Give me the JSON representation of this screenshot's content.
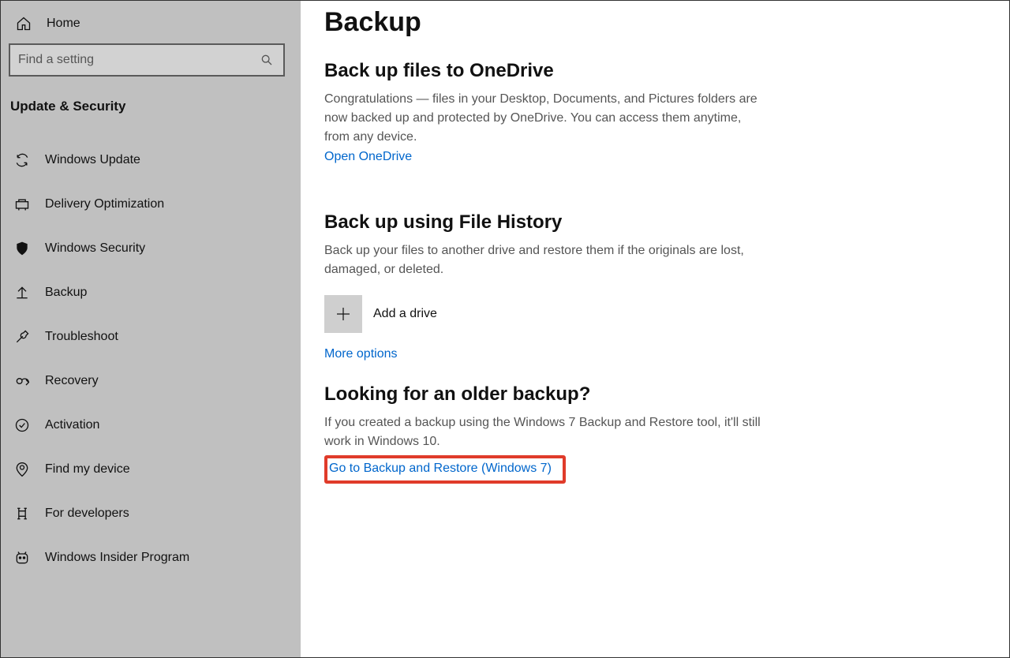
{
  "sidebar": {
    "home_label": "Home",
    "search_placeholder": "Find a setting",
    "category": "Update & Security",
    "items": [
      {
        "label": "Windows Update",
        "icon": "sync-icon"
      },
      {
        "label": "Delivery Optimization",
        "icon": "delivery-icon"
      },
      {
        "label": "Windows Security",
        "icon": "shield-icon"
      },
      {
        "label": "Backup",
        "icon": "backup-icon"
      },
      {
        "label": "Troubleshoot",
        "icon": "wrench-icon"
      },
      {
        "label": "Recovery",
        "icon": "recovery-icon"
      },
      {
        "label": "Activation",
        "icon": "check-circle-icon"
      },
      {
        "label": "Find my device",
        "icon": "location-icon"
      },
      {
        "label": "For developers",
        "icon": "developer-icon"
      },
      {
        "label": "Windows Insider Program",
        "icon": "insider-icon"
      }
    ]
  },
  "main": {
    "page_title": "Backup",
    "sections": {
      "onedrive": {
        "heading": "Back up files to OneDrive",
        "text": "Congratulations — files in your Desktop, Documents, and Pictures folders are now backed up and protected by OneDrive. You can access them anytime, from any device.",
        "link": "Open OneDrive"
      },
      "filehistory": {
        "heading": "Back up using File History",
        "text": "Back up your files to another drive and restore them if the originals are lost, damaged, or deleted.",
        "add_label": "Add a drive",
        "more_link": "More options"
      },
      "older": {
        "heading": "Looking for an older backup?",
        "text": "If you created a backup using the Windows 7 Backup and Restore tool, it'll still work in Windows 10.",
        "link": "Go to Backup and Restore (Windows 7)"
      }
    }
  }
}
